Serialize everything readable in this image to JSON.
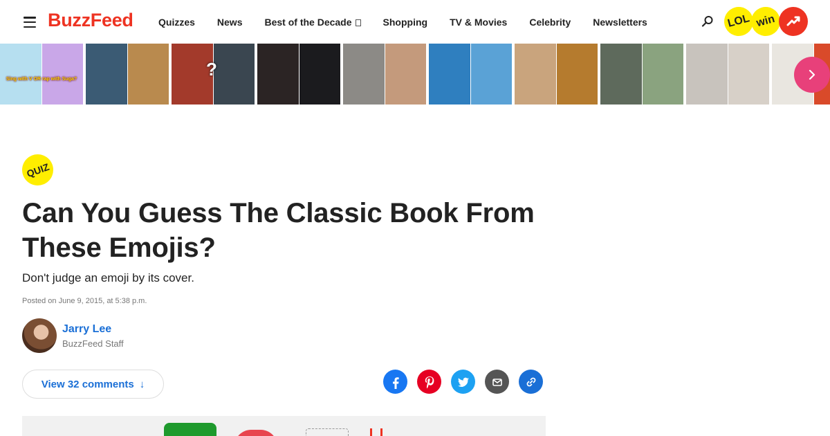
{
  "header": {
    "logo": "BuzzFeed",
    "nav": [
      {
        "label": "Quizzes"
      },
      {
        "label": "News"
      },
      {
        "label": "Best of the Decade",
        "has_icon": true
      },
      {
        "label": "Shopping"
      },
      {
        "label": "TV & Movies"
      },
      {
        "label": "Celebrity"
      },
      {
        "label": "Newsletters"
      }
    ],
    "badges": {
      "lol": "LOL",
      "win": "win"
    }
  },
  "strip": {
    "items": [
      {
        "caption": "Sing with V OR rap with Suga?",
        "colors": [
          "#b6dff0",
          "#c9a7e8"
        ]
      },
      {
        "caption": "",
        "colors": [
          "#3b5b74",
          "#b98a4e"
        ]
      },
      {
        "caption": "",
        "colors": [
          "#a33a2b",
          "#3a4650"
        ],
        "mark": "?"
      },
      {
        "caption": "",
        "colors": [
          "#2b2424",
          "#1b1b1e"
        ]
      },
      {
        "caption": "",
        "colors": [
          "#8c8a86",
          "#c49a7c"
        ]
      },
      {
        "caption": "",
        "colors": [
          "#2f7fbf",
          "#5aa2d6"
        ]
      },
      {
        "caption": "",
        "colors": [
          "#c9a47d",
          "#b57b2e"
        ]
      },
      {
        "caption": "",
        "colors": [
          "#5e6a5c",
          "#8aa37f"
        ]
      },
      {
        "caption": "",
        "colors": [
          "#c8c3bd",
          "#d7d0c8"
        ]
      },
      {
        "caption": "",
        "colors": [
          "#e9e6e0",
          "#d94a2a"
        ]
      }
    ]
  },
  "article": {
    "badge": "QUIZ",
    "title": "Can You Guess The Classic Book From These Emojis?",
    "subtitle": "Don't judge an emoji by its cover.",
    "posted": "Posted on June 9, 2015, at 5:38 p.m.",
    "author": {
      "name": "Jarry Lee",
      "role": "BuzzFeed Staff"
    },
    "comments": {
      "label": "View 32 comments",
      "arrow": "↓"
    }
  },
  "colors": {
    "brand": "#ee3322",
    "link": "#1a6fd6",
    "quiz_yellow": "#ffee00"
  },
  "icons": [
    "hamburger-icon",
    "search-icon",
    "trending-icon",
    "chevron-right-icon",
    "facebook-icon",
    "pinterest-icon",
    "twitter-icon",
    "mail-icon",
    "link-icon"
  ]
}
